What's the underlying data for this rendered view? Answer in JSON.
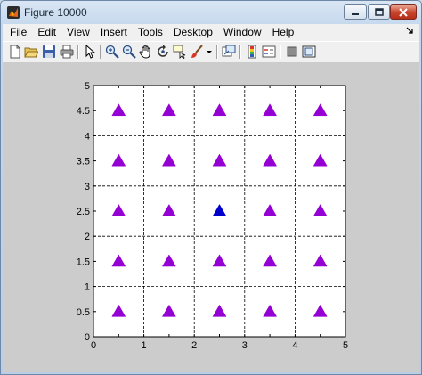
{
  "window": {
    "title": "Figure 10000",
    "controls": [
      "minimize",
      "maximize",
      "close"
    ]
  },
  "menubar": {
    "items": [
      {
        "label": "File"
      },
      {
        "label": "Edit"
      },
      {
        "label": "View"
      },
      {
        "label": "Insert"
      },
      {
        "label": "Tools"
      },
      {
        "label": "Desktop"
      },
      {
        "label": "Window"
      },
      {
        "label": "Help"
      }
    ]
  },
  "toolbar": {
    "icons": [
      "new-figure-icon",
      "open-file-icon",
      "save-icon",
      "print-icon",
      "edit-plot-arrow-icon",
      "zoom-in-icon",
      "zoom-out-icon",
      "pan-hand-icon",
      "rotate-3d-icon",
      "data-cursor-icon",
      "brush-icon",
      "brush-dropdown-icon",
      "link-plot-icon",
      "insert-colorbar-icon",
      "insert-legend-icon",
      "hide-plot-tools-icon",
      "show-plot-tools-icon"
    ]
  },
  "colors": {
    "figure_background": "#cccccc",
    "axes_background": "#ffffff",
    "marker_default": "#9400d3",
    "marker_highlight": "#0000cd",
    "grid": "#000000"
  },
  "chart_data": {
    "type": "scatter",
    "marker": "triangle-up",
    "xlim": [
      0,
      5
    ],
    "ylim": [
      0,
      5
    ],
    "xticks": [
      "0",
      "0.5",
      "1",
      "1.5",
      "2",
      "2.5",
      "3",
      "3.5",
      "4",
      "4.5",
      "5"
    ],
    "yticks": [
      "0",
      "0.5",
      "1",
      "1.5",
      "2",
      "2.5",
      "3",
      "3.5",
      "4",
      "4.5",
      "5"
    ],
    "grid": "dashed at integer values",
    "series": [
      {
        "color": "#9400d3",
        "points": [
          [
            0.5,
            0.5
          ],
          [
            1.5,
            0.5
          ],
          [
            2.5,
            0.5
          ],
          [
            3.5,
            0.5
          ],
          [
            4.5,
            0.5
          ],
          [
            0.5,
            1.5
          ],
          [
            1.5,
            1.5
          ],
          [
            2.5,
            1.5
          ],
          [
            3.5,
            1.5
          ],
          [
            4.5,
            1.5
          ],
          [
            0.5,
            2.5
          ],
          [
            1.5,
            2.5
          ],
          [
            3.5,
            2.5
          ],
          [
            4.5,
            2.5
          ],
          [
            0.5,
            3.5
          ],
          [
            1.5,
            3.5
          ],
          [
            2.5,
            3.5
          ],
          [
            3.5,
            3.5
          ],
          [
            4.5,
            3.5
          ],
          [
            0.5,
            4.5
          ],
          [
            1.5,
            4.5
          ],
          [
            2.5,
            4.5
          ],
          [
            3.5,
            4.5
          ],
          [
            4.5,
            4.5
          ]
        ]
      },
      {
        "color": "#0000cd",
        "points": [
          [
            2.5,
            2.5
          ]
        ]
      }
    ]
  }
}
